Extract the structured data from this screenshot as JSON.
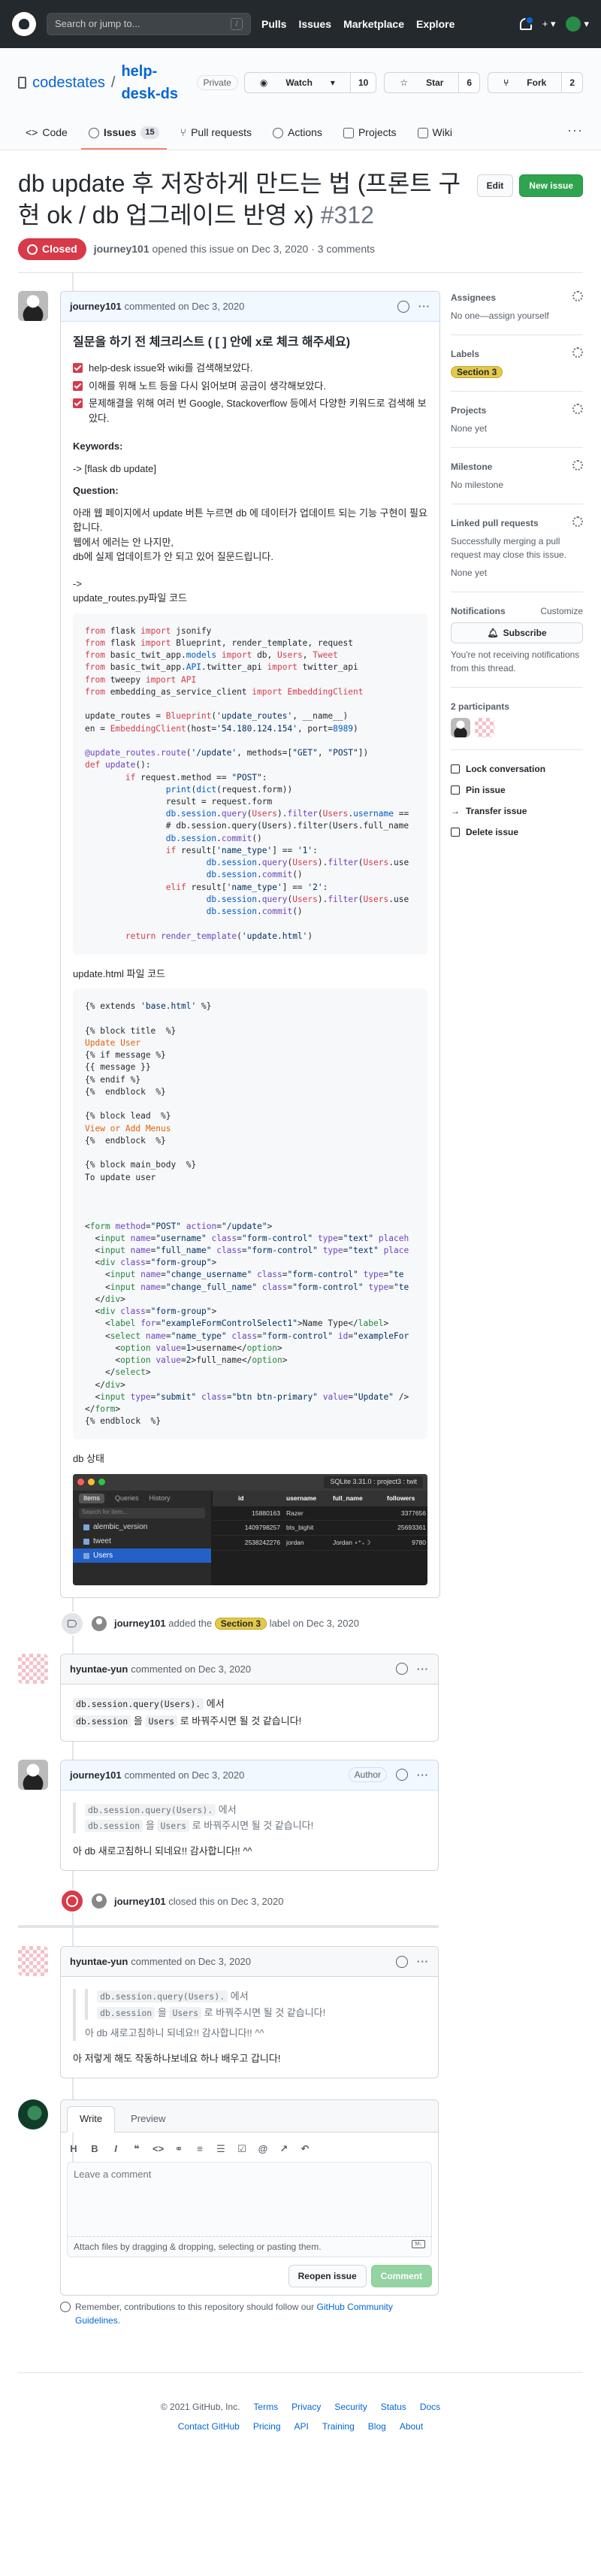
{
  "header": {
    "search_placeholder": "Search or jump to...",
    "search_key": "/",
    "nav": [
      "Pulls",
      "Issues",
      "Marketplace",
      "Explore"
    ],
    "plus": "+",
    "caret": "▾"
  },
  "repo": {
    "owner": "codestates",
    "name": "help-desk-ds",
    "visibility": "Private",
    "watch_label": "Watch",
    "watch_count": "10",
    "star_label": "Star",
    "star_count": "6",
    "fork_label": "Fork",
    "fork_count": "2",
    "tabs": [
      {
        "label": "Code"
      },
      {
        "label": "Issues",
        "count": "15"
      },
      {
        "label": "Pull requests"
      },
      {
        "label": "Actions"
      },
      {
        "label": "Projects"
      },
      {
        "label": "Wiki"
      }
    ],
    "more": "···"
  },
  "issue": {
    "title": "db update 후 저장하게 만드는 법 (프론트 구현 ok / db 업그레이드 반영 x)",
    "number": "#312",
    "edit_label": "Edit",
    "new_issue_label": "New issue",
    "state": "Closed",
    "author": "journey101",
    "meta_text": "opened this issue on Dec 3, 2020 · 3 comments"
  },
  "comments": [
    {
      "author": "journey101",
      "meta": "commented on Dec 3, 2020",
      "heading": "질문을 하기 전 체크리스트 ( [ ] 안에 x로 체크 해주세요)",
      "tasks": [
        "help-desk issue와 wiki를 검색해보았다.",
        "이해를 위해 노트 등을 다시 읽어보며 공금이 생각해보았다.",
        "문제해결을 위해 여러 번 Google, Stackoverflow 등에서 다양한 키워드로 검색해 보았다."
      ],
      "keywords_label": "Keywords:",
      "keywords_value": "-> [flask db update]",
      "question_label": "Question:",
      "question_lines": [
        "아래 웹 페이지에서 update 버튼 누르면 db 에 데이터가 업데이트 되는 기능 구현이 필요합니다.",
        "웹에서 에러는 안 나지만,",
        "db에 실제 업데이트가 안 되고 있어 질문드립니다."
      ],
      "arrow": "->",
      "file1_label": "update_routes.py파일 코드",
      "file2_label": "update.html 파일 코드",
      "db_state_label": "db 상태"
    },
    {
      "author": "hyuntae-yun",
      "meta": "commented on Dec 3, 2020",
      "line1_code": "db.session.query(Users).",
      "line1_text": " 에서",
      "line2_code_a": "db.session",
      "line2_mid": " 을 ",
      "line2_code_b": "Users",
      "line2_text": " 로 바꿔주시면 될 것 같습니다!"
    },
    {
      "author": "journey101",
      "meta": "commented on Dec 3, 2020",
      "badge": "Author",
      "reply": "아 db 새로고침하니 되네요!! 감사합니다!! ^^"
    },
    {
      "author": "hyuntae-yun",
      "meta": "commented on Dec 3, 2020",
      "reply": "아 저렇게 해도 작동하나보네요 하나 배우고 갑니다!"
    }
  ],
  "events": {
    "label_actor": "journey101",
    "label_prefix": " added the ",
    "label_name": "Section 3",
    "label_suffix": " label on Dec 3, 2020",
    "close_actor": "journey101",
    "close_text": " closed this on Dec 3, 2020"
  },
  "db_screenshot": {
    "title": "SQLite 3.31.0 : project3 : twit",
    "side_tabs": [
      "Items",
      "Queries",
      "History"
    ],
    "search": "Search for item...",
    "items": [
      "alembic_version",
      "tweet",
      "Users"
    ],
    "columns": [
      "id",
      "username",
      "full_name",
      "followers"
    ],
    "rows": [
      [
        "15880163",
        "Razer",
        "",
        "3377656"
      ],
      [
        "1409798257",
        "bts_bighit",
        "",
        "25693361"
      ],
      [
        "2538242276",
        "jordan",
        "Jordan ⋆⁺₊☽",
        "9780"
      ]
    ]
  },
  "new_comment": {
    "tabs": [
      "Write",
      "Preview"
    ],
    "placeholder": "Leave a comment",
    "attach": "Attach files by dragging & dropping, selecting or pasting them.",
    "reopen": "Reopen issue",
    "comment": "Comment",
    "tip_prefix": "Remember, contributions to this repository should follow our ",
    "tip_link": "GitHub Community Guidelines",
    "tip_suffix": "."
  },
  "sidebar": {
    "assignees_title": "Assignees",
    "assignees_value": "No one—assign yourself",
    "labels_title": "Labels",
    "labels_value": "Section 3",
    "projects_title": "Projects",
    "projects_value": "None yet",
    "milestone_title": "Milestone",
    "milestone_value": "No milestone",
    "linked_title": "Linked pull requests",
    "linked_desc": "Successfully merging a pull request may close this issue.",
    "linked_value": "None yet",
    "notifications_title": "Notifications",
    "customize": "Customize",
    "subscribe": "Subscribe",
    "notif_desc": "You're not receiving notifications from this thread.",
    "participants": "2 participants",
    "actions": [
      "Lock conversation",
      "Pin issue",
      "Transfer issue",
      "Delete issue"
    ]
  },
  "footer": {
    "copyright": "© 2021 GitHub, Inc.",
    "row1": [
      "Terms",
      "Privacy",
      "Security",
      "Status",
      "Docs"
    ],
    "row2": [
      "Contact GitHub",
      "Pricing",
      "API",
      "Training",
      "Blog",
      "About"
    ]
  },
  "colors": {
    "closed": "#d73a49",
    "label": "#e4c94a",
    "green": "#2ea44f",
    "tab_accent": "#f9826c"
  }
}
